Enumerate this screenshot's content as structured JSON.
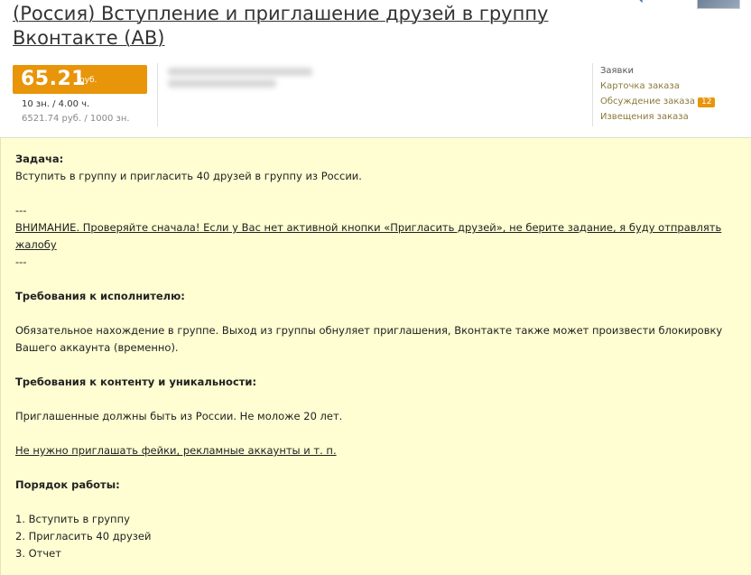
{
  "title": {
    "line1": "(Россия) Вступление и приглашение друзей в группу",
    "line2": "Вконтакте (АВ)"
  },
  "price": {
    "value": "65.21",
    "currency": "руб.",
    "line1": "10 зн. / 4.00 ч.",
    "line2": "6521.74 руб. / 1000 зн."
  },
  "side_links": {
    "applications": "Заявки",
    "order_card": "Карточка заказа",
    "discussion": "Обсуждение заказа",
    "discussion_count": "12",
    "notifications": "Извещения заказа"
  },
  "task": {
    "heading": "Задача:",
    "line1": "Вступить в группу и пригласить 40 друзей в группу из России.",
    "sep1": "---",
    "warning": "ВНИМАНИЕ. Проверяйте сначала! Если у Вас нет активной кнопки «Пригласить друзей», не берите задание, я буду отправлять жалобу",
    "sep2": "---",
    "req_exec_heading": "Требования к исполнителю:",
    "req_exec_text": "Обязательное нахождение в группе. Выход из группы обнуляет приглашения, Вконтакте также может произвести блокировку Вашего аккаунта (временно).",
    "req_content_heading": "Требования к контенту и уникальности:",
    "req_content_text": "Приглашенные должны быть из России. Не моложе 20 лет.",
    "no_fakes": "Не нужно приглашать фейки, рекламные аккаунты и т. п.",
    "order_heading": "Порядок работы:",
    "steps": [
      "1. Вступить в группу",
      "2. Пригласить 40 друзей",
      "3. Отчет"
    ]
  }
}
